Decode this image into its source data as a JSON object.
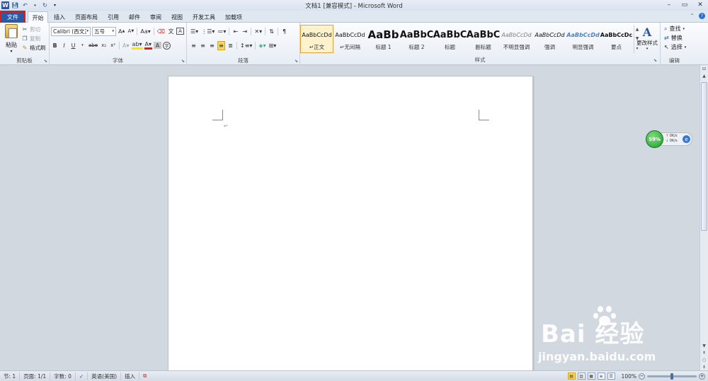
{
  "title_bar": {
    "title": "文档1 [兼容模式] - Microsoft Word",
    "app_icon": "W",
    "qat_icons": [
      "word-logo",
      "save-icon",
      "undo-icon",
      "redo-icon",
      "customize-icon"
    ]
  },
  "tabs": [
    "文件",
    "开始",
    "插入",
    "页面布局",
    "引用",
    "邮件",
    "审阅",
    "视图",
    "开发工具",
    "加载项"
  ],
  "clipboard": {
    "label": "剪贴板",
    "paste": "粘贴",
    "cut": "剪切",
    "copy": "复制",
    "format_painter": "格式刷"
  },
  "font": {
    "label": "字体",
    "font_name": "Calibri (西文正",
    "font_size": "五号",
    "row2": [
      "B",
      "I",
      "U",
      "abe",
      "x₂",
      "x²"
    ]
  },
  "paragraph": {
    "label": "段落"
  },
  "styles": {
    "label": "样式",
    "items": [
      {
        "sample": "AaBbCcDd",
        "name": "正文"
      },
      {
        "sample": "AaBbCcDd",
        "name": "无间隔"
      },
      {
        "sample": "AaBb",
        "name": "标题 1"
      },
      {
        "sample": "AaBbC",
        "name": "标题 2"
      },
      {
        "sample": "AaBbC",
        "name": "标题"
      },
      {
        "sample": "AaBbC",
        "name": "副标题"
      },
      {
        "sample": "AaBbCcDd",
        "name": "不明显强调"
      },
      {
        "sample": "AaBbCcDd",
        "name": "强调"
      },
      {
        "sample": "AaBbCcDd",
        "name": "明显强调"
      },
      {
        "sample": "AaBbCcDc",
        "name": "要点"
      }
    ],
    "change_styles": "更改样式"
  },
  "editing": {
    "label": "编辑",
    "find": "查找",
    "replace": "替换",
    "select": "选择"
  },
  "network_widget": {
    "percent": "59%",
    "up": "0K/s",
    "down": "0K/s"
  },
  "watermark": {
    "brand": "Bai  经验",
    "url": "jingyan.baidu.com"
  },
  "status_bar": {
    "section": "节: 1",
    "page": "页面: 1/1",
    "words": "字数: 0",
    "language": "英语(美国)",
    "mode": "插入",
    "zoom": "100%"
  },
  "colors": {
    "file_tab": "#2a5aa5",
    "highlight_box": "#d51f1f",
    "active_style": "#e1a43c"
  }
}
